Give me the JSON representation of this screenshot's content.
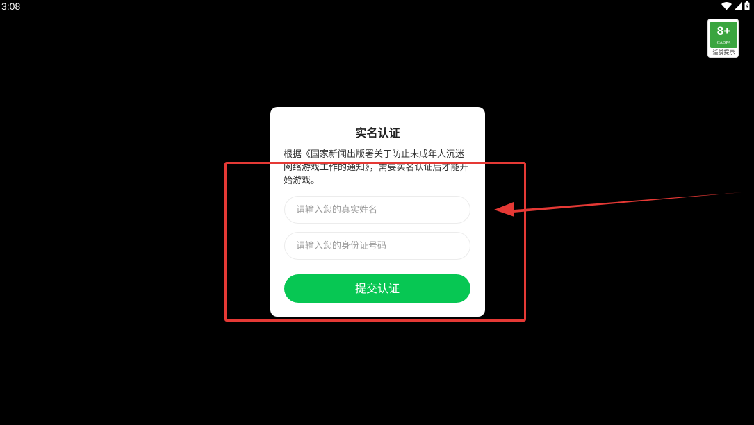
{
  "status_bar": {
    "time": "3:08",
    "icons": [
      "wifi-icon",
      "signal-icon",
      "battery-icon"
    ]
  },
  "age_badge": {
    "age": "8+",
    "org": "CADPA",
    "tip": "适龄提示",
    "color": "#3aa53f"
  },
  "dialog": {
    "title": "实名认证",
    "description": "根据《国家新闻出版署关于防止未成年人沉迷网络游戏工作的通知》，需要实名认证后才能开始游戏。",
    "name_placeholder": "请输入您的真实姓名",
    "id_placeholder": "请输入您的身份证号码",
    "submit_label": "提交认证",
    "submit_color": "#07c753"
  },
  "annotation": {
    "highlight_color": "#e53935",
    "arrow_color": "#e53935"
  }
}
